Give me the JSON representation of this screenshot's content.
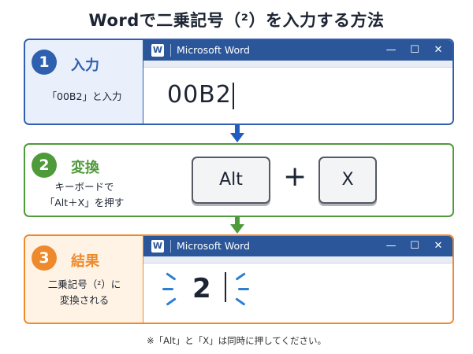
{
  "page": {
    "title": "Wordで二乗記号（²）を入力する方法"
  },
  "step1": {
    "number": "1",
    "heading": "入力",
    "desc": "「00B2」と入力",
    "window_title": "Microsoft Word",
    "typed_text": "00B2"
  },
  "step2": {
    "number": "2",
    "heading": "変換",
    "desc_line1": "キーボードで",
    "desc_line2": "「Alt＋X」を押す",
    "key1": "Alt",
    "plus": "+",
    "key2": "X"
  },
  "step3": {
    "number": "3",
    "heading": "結果",
    "desc_line1": "二乗記号（²）に",
    "desc_line2": "変換される",
    "window_title": "Microsoft Word",
    "result_text": "2"
  },
  "footnote": "※「Alt」と「X」は同時に押してください。",
  "icons": {
    "word_logo": "W",
    "minimize": "—",
    "maximize": "☐",
    "close": "✕"
  },
  "colors": {
    "step1": "#2f5faf",
    "step2": "#4f9a3a",
    "step3": "#ee8a2e",
    "word_blue": "#2b579a"
  }
}
